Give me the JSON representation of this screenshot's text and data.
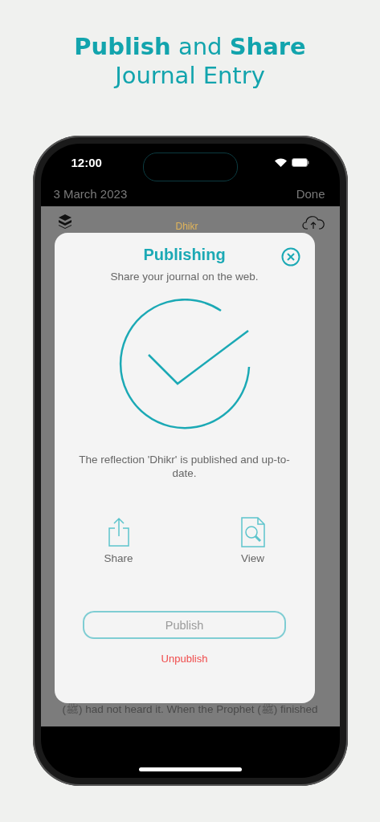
{
  "headline": {
    "line_1": "**Publish** and **Share**",
    "line_2": "Journal Entry"
  },
  "status_bar": {
    "time": "12:00"
  },
  "nav_bar": {
    "title": "3 March 2023",
    "action": "Done"
  },
  "entry": {
    "title": "Dhikr",
    "visible_text": "(ﷺ) had not heard it. When the Prophet (ﷺ) finished"
  },
  "dialog": {
    "title": "Publishing",
    "subtitle": "Share your journal on the web.",
    "status_published": true,
    "message": "The reflection 'Dhikr' is published and up-to-date.",
    "actions": [
      {
        "kind": "share",
        "label": "Share"
      },
      {
        "kind": "view",
        "label": "View"
      }
    ],
    "publish_button": {
      "label": "Publish",
      "disabled": true
    },
    "unpublish_link": "Unpublish"
  }
}
